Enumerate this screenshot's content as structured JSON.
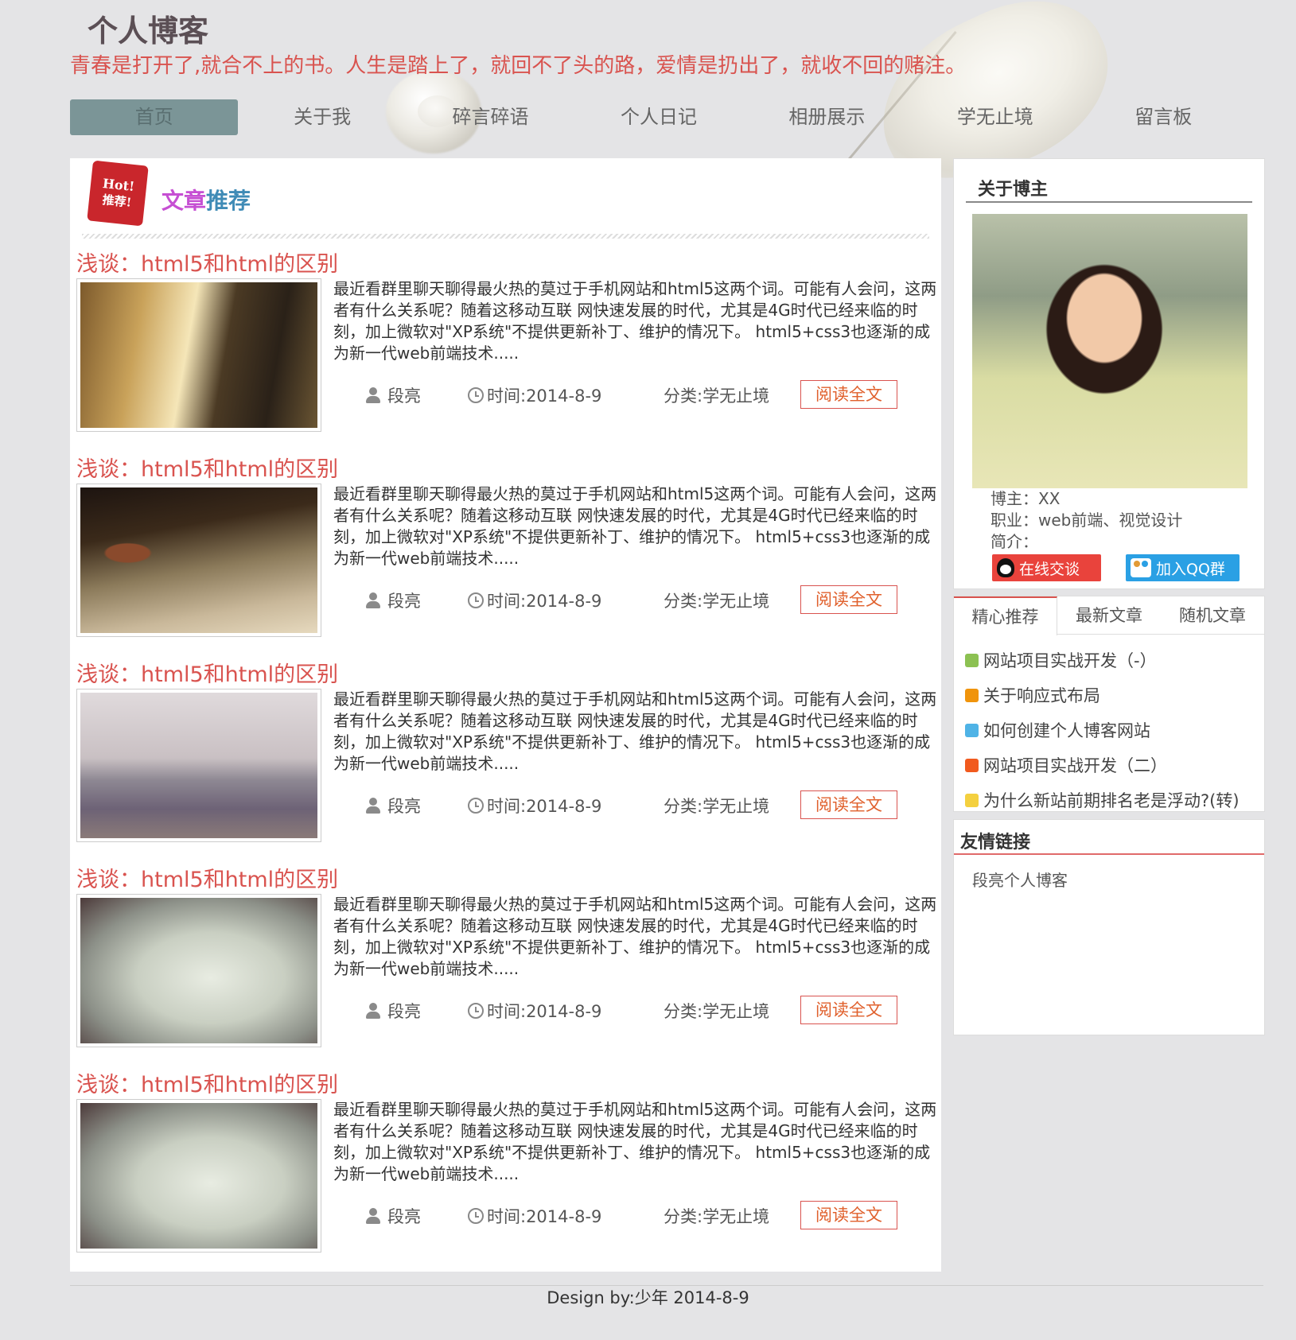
{
  "header": {
    "title": "个人博客",
    "slogan": "青春是打开了,就合不上的书。人生是踏上了，就回不了头的路，爱情是扔出了，就收不回的赌注。"
  },
  "nav": {
    "items": [
      "首页",
      "关于我",
      "碎言碎语",
      "个人日记",
      "相册展示",
      "学无止境",
      "留言板"
    ],
    "active_index": 0
  },
  "recommend": {
    "badge_line1": "Hot!",
    "badge_line2": "推荐!",
    "title_word1": "文章",
    "title_word2": "推荐"
  },
  "articles": [
    {
      "title": "浅谈：html5和html的区别",
      "body": "最近看群里聊天聊得最火热的莫过于手机网站和html5这两个词。可能有人会问，这两者有什么关系呢？随着这移动互联 网快速发展的时代，尤其是4G时代已经来临的时刻，加上微软对\"XP系统\"不提供更新补丁、维护的情况下。 html5+css3也逐渐的成为新一代web前端技术.....",
      "author": "段亮",
      "time": "时间:2014-8-9",
      "category": "分类:学无止境",
      "read_more": "阅读全文"
    },
    {
      "title": "浅谈：html5和html的区别",
      "body": "最近看群里聊天聊得最火热的莫过于手机网站和html5这两个词。可能有人会问，这两者有什么关系呢？随着这移动互联 网快速发展的时代，尤其是4G时代已经来临的时刻，加上微软对\"XP系统\"不提供更新补丁、维护的情况下。 html5+css3也逐渐的成为新一代web前端技术.....",
      "author": "段亮",
      "time": "时间:2014-8-9",
      "category": "分类:学无止境",
      "read_more": "阅读全文"
    },
    {
      "title": "浅谈：html5和html的区别",
      "body": "最近看群里聊天聊得最火热的莫过于手机网站和html5这两个词。可能有人会问，这两者有什么关系呢？随着这移动互联 网快速发展的时代，尤其是4G时代已经来临的时刻，加上微软对\"XP系统\"不提供更新补丁、维护的情况下。 html5+css3也逐渐的成为新一代web前端技术.....",
      "author": "段亮",
      "time": "时间:2014-8-9",
      "category": "分类:学无止境",
      "read_more": "阅读全文"
    },
    {
      "title": "浅谈：html5和html的区别",
      "body": "最近看群里聊天聊得最火热的莫过于手机网站和html5这两个词。可能有人会问，这两者有什么关系呢？随着这移动互联 网快速发展的时代，尤其是4G时代已经来临的时刻，加上微软对\"XP系统\"不提供更新补丁、维护的情况下。 html5+css3也逐渐的成为新一代web前端技术.....",
      "author": "段亮",
      "time": "时间:2014-8-9",
      "category": "分类:学无止境",
      "read_more": "阅读全文"
    },
    {
      "title": "浅谈：html5和html的区别",
      "body": "最近看群里聊天聊得最火热的莫过于手机网站和html5这两个词。可能有人会问，这两者有什么关系呢？随着这移动互联 网快速发展的时代，尤其是4G时代已经来临的时刻，加上微软对\"XP系统\"不提供更新补丁、维护的情况下。 html5+css3也逐渐的成为新一代web前端技术.....",
      "author": "段亮",
      "time": "时间:2014-8-9",
      "category": "分类:学无止境",
      "read_more": "阅读全文"
    }
  ],
  "about": {
    "heading": "关于博主",
    "blogger": "博主：XX",
    "job": "职业：web前端、视觉设计",
    "intro": "简介：",
    "chat_button": "在线交谈",
    "qq_group_button": "加入QQ群"
  },
  "tabs": {
    "labels": [
      "精心推荐",
      "最新文章",
      "随机文章"
    ],
    "active_index": 0,
    "items": [
      {
        "text": "网站项目实战开发（-）",
        "color": "#8cc152"
      },
      {
        "text": "关于响应式布局",
        "color": "#f0940c"
      },
      {
        "text": "如何创建个人博客网站",
        "color": "#4fb3e6"
      },
      {
        "text": "网站项目实战开发（二）",
        "color": "#f15a1e"
      },
      {
        "text": "为什么新站前期排名老是浮动?(转)",
        "color": "#f4d03f"
      }
    ]
  },
  "links": {
    "heading": "友情链接",
    "items": [
      "段亮个人博客"
    ]
  },
  "footer": {
    "text": "Design by:少年 2014-8-9"
  },
  "colors": {
    "accent_red": "#d9534f",
    "nav_active": "#7b9597",
    "page_bg": "#e4e4e6"
  }
}
